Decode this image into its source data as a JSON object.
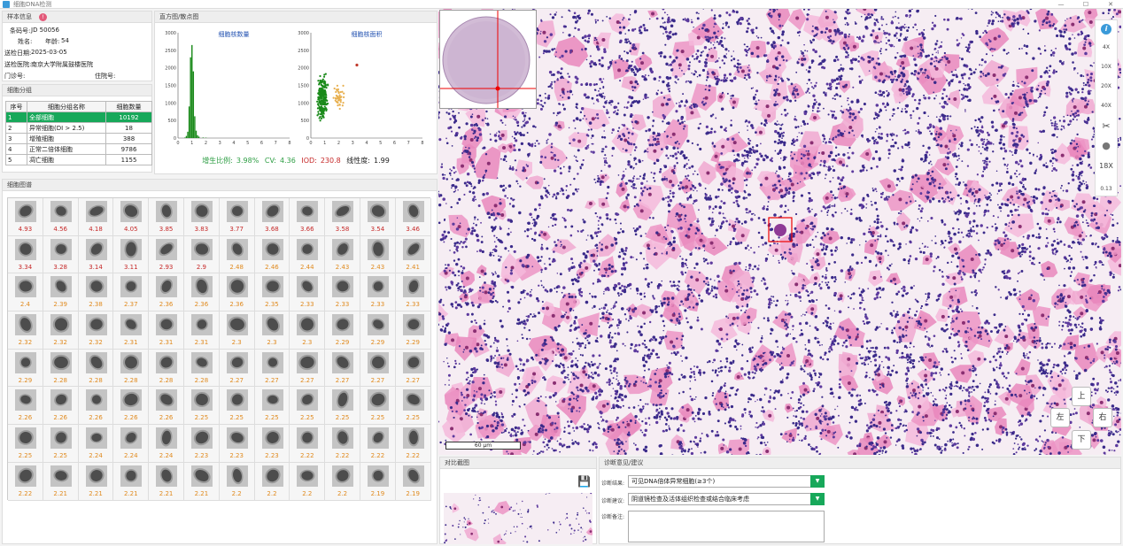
{
  "window": {
    "title": "细胞DNA检测"
  },
  "sample_info": {
    "header": "样本信息",
    "rows": [
      {
        "label": "条码号:",
        "value": "JD 50056"
      },
      {
        "label": "姓名:",
        "value": ""
      },
      {
        "label": "年龄:",
        "value": "54"
      },
      {
        "label": "送检日期:",
        "value": "2025-03-05"
      },
      {
        "label": "送检医院:",
        "value": "南京大学附属鼓楼医院"
      },
      {
        "label": "门诊号:",
        "value": ""
      },
      {
        "label": "住院号:",
        "value": ""
      }
    ]
  },
  "classification": {
    "header": "细胞分组",
    "columns": [
      "序号",
      "细胞分组名称",
      "细胞数量"
    ],
    "rows": [
      {
        "id": "1",
        "name": "全部细胞",
        "count": "10192"
      },
      {
        "id": "2",
        "name": "异常细胞(DI > 2.5)",
        "count": "18"
      },
      {
        "id": "3",
        "name": "增殖细胞",
        "count": "388"
      },
      {
        "id": "4",
        "name": "正常二倍体细胞",
        "count": "9786"
      },
      {
        "id": "5",
        "name": "凋亡细胞",
        "count": "1155"
      }
    ]
  },
  "histogram": {
    "header": "直方图/散点图",
    "stats": {
      "prolif_label": "增生比例:",
      "prolif_value": "3.98%",
      "cv_label": "CV:",
      "cv_value": "4.36",
      "iod_label": "IOD:",
      "iod_value": "230.8",
      "lin_label": "线性度:",
      "lin_value": "1.99"
    }
  },
  "chart_data": [
    {
      "type": "bar",
      "title": "细胞核数量",
      "x": [
        0.5,
        0.6,
        0.7,
        0.8,
        0.9,
        1.0,
        1.1,
        1.2,
        1.3,
        1.4,
        1.5,
        1.8,
        2.0
      ],
      "values": [
        15,
        60,
        180,
        900,
        2300,
        2650,
        1900,
        620,
        210,
        80,
        40,
        15,
        10
      ],
      "xlim": [
        0,
        8
      ],
      "ylim": [
        0,
        3000
      ],
      "xticks": [
        "0",
        "1",
        "2",
        "3",
        "4",
        "5",
        "6",
        "7",
        "8"
      ],
      "yticks": [
        "0",
        "500",
        "1000",
        "1500",
        "2000",
        "2500",
        "3000"
      ],
      "color": "#1a8a1a"
    },
    {
      "type": "scatter",
      "title": "细胞核面积",
      "xlim": [
        0,
        8
      ],
      "ylim": [
        0,
        3000
      ],
      "xticks": [
        "0",
        "1",
        "2",
        "3",
        "4",
        "5",
        "6",
        "7",
        "8"
      ],
      "yticks": [
        "0",
        "500",
        "1000",
        "1500",
        "2000",
        "2500",
        "3000"
      ],
      "series": [
        {
          "color": "#1a8a1a",
          "cluster": {
            "x": [
              0.4,
              1.3
            ],
            "y": [
              400,
              1900
            ]
          }
        },
        {
          "color": "#e8b050",
          "cluster": {
            "x": [
              1.4,
              2.6
            ],
            "y": [
              700,
              1700
            ]
          }
        },
        {
          "color": "#c0392b",
          "points": [
            [
              3.3,
              2080
            ]
          ]
        }
      ]
    }
  ],
  "gallery": {
    "header": "细胞图谱",
    "values": [
      "4.93",
      "4.56",
      "4.18",
      "4.05",
      "3.85",
      "3.83",
      "3.77",
      "3.68",
      "3.66",
      "3.58",
      "3.54",
      "3.46",
      "3.34",
      "3.28",
      "3.14",
      "3.11",
      "2.93",
      "2.9",
      "2.48",
      "2.46",
      "2.44",
      "2.43",
      "2.43",
      "2.41",
      "2.4",
      "2.39",
      "2.38",
      "2.37",
      "2.36",
      "2.36",
      "2.36",
      "2.35",
      "2.33",
      "2.33",
      "2.33",
      "2.33",
      "2.32",
      "2.32",
      "2.32",
      "2.31",
      "2.31",
      "2.31",
      "2.3",
      "2.3",
      "2.3",
      "2.29",
      "2.29",
      "2.29",
      "2.29",
      "2.28",
      "2.28",
      "2.28",
      "2.28",
      "2.28",
      "2.27",
      "2.27",
      "2.27",
      "2.27",
      "2.27",
      "2.27",
      "2.26",
      "2.26",
      "2.26",
      "2.26",
      "2.26",
      "2.25",
      "2.25",
      "2.25",
      "2.25",
      "2.25",
      "2.25",
      "2.25",
      "2.25",
      "2.25",
      "2.24",
      "2.24",
      "2.24",
      "2.23",
      "2.23",
      "2.23",
      "2.22",
      "2.22",
      "2.22",
      "2.22",
      "2.22",
      "2.21",
      "2.21",
      "2.21",
      "2.21",
      "2.21",
      "2.2",
      "2.2",
      "2.2",
      "2.2",
      "2.19",
      "2.19"
    ],
    "red_color": "#c62828",
    "orange_color": "#e08a1e"
  },
  "viewer": {
    "scale_label": "60 μm",
    "zoom_items": [
      {
        "label": "i",
        "icon": "info-icon"
      },
      {
        "label": "4X"
      },
      {
        "label": "10X"
      },
      {
        "label": "20X"
      },
      {
        "label": "40X"
      },
      {
        "label": "✂",
        "icon": "scissors-icon"
      },
      {
        "label": "●",
        "icon": "circle-icon"
      },
      {
        "label": "18X"
      },
      {
        "label": "0.13"
      }
    ],
    "nav": {
      "up": "上",
      "down": "下",
      "left": "左",
      "right": "右"
    }
  },
  "screenshot": {
    "header": "对比截图"
  },
  "diagnosis": {
    "header": "诊断意见/建议",
    "result_label": "诊断结果:",
    "result_value": "可见DNA倍体异常细胞(≥3个)",
    "suggest_label": "诊断建议:",
    "suggest_value": "阴道镜检查及活体组织检查或结合临床考虑",
    "note_label": "诊断备注:",
    "note_value": ""
  }
}
